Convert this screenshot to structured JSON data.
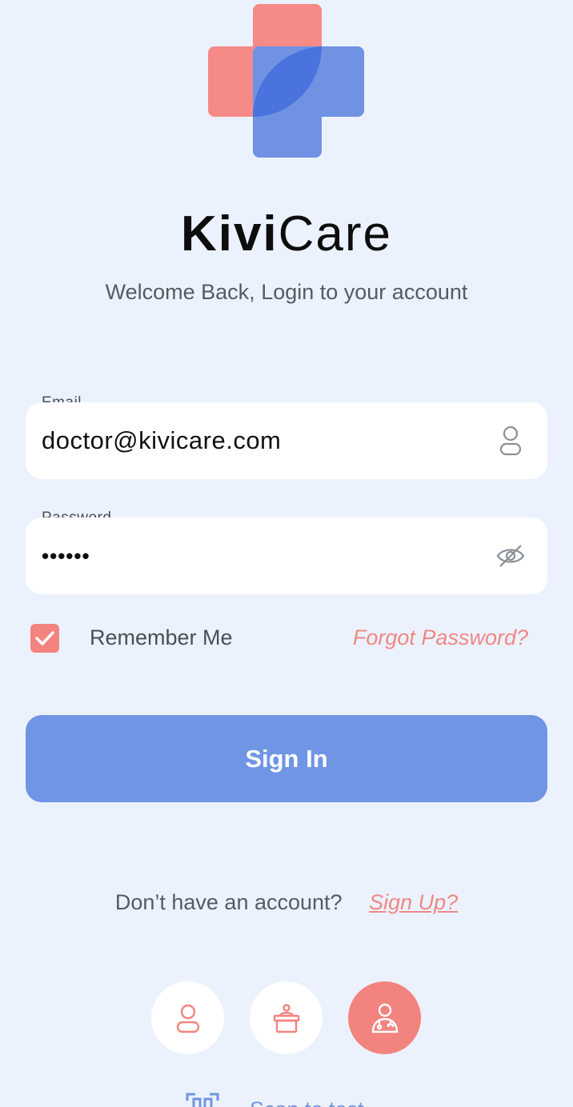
{
  "app": {
    "brand_bold": "Kivi",
    "brand_light": "Care",
    "subtitle": "Welcome Back, Login to your account"
  },
  "form": {
    "email_label": "Email",
    "email_value": "doctor@kivicare.com",
    "password_label": "Password",
    "password_value": "••••••",
    "remember_label": "Remember Me",
    "remember_checked": true,
    "forgot_label": "Forgot Password?",
    "signin_label": "Sign In"
  },
  "footer": {
    "no_account": "Don’t have an account?",
    "signup_label": "Sign Up?",
    "scan_label": "Scan to test"
  },
  "roles": [
    {
      "icon": "patient-icon",
      "active": false
    },
    {
      "icon": "receptionist-icon",
      "active": false
    },
    {
      "icon": "doctor-icon",
      "active": true
    }
  ],
  "colors": {
    "background": "#ecf2fd",
    "primary": "#7095e4",
    "accent": "#f3837f",
    "logo_red": "#f58a87",
    "logo_blue": "#6f92e3"
  }
}
